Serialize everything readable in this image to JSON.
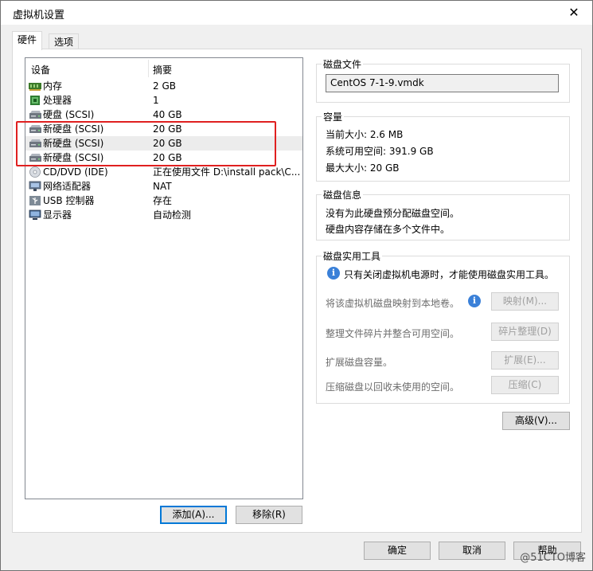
{
  "window": {
    "title": "虚拟机设置",
    "close_glyph": "✕"
  },
  "tabs": [
    {
      "label": "硬件"
    },
    {
      "label": "选项"
    }
  ],
  "device_list": {
    "col_device": "设备",
    "col_summary": "摘要",
    "rows": [
      {
        "name": "内存",
        "summary": "2 GB",
        "icon": "memory-icon"
      },
      {
        "name": "处理器",
        "summary": "1",
        "icon": "processor-icon"
      },
      {
        "name": "硬盘 (SCSI)",
        "summary": "40 GB",
        "icon": "hard-disk-icon"
      },
      {
        "name": "新硬盘 (SCSI)",
        "summary": "20 GB",
        "icon": "hard-disk-icon"
      },
      {
        "name": "新硬盘 (SCSI)",
        "summary": "20 GB",
        "icon": "hard-disk-icon"
      },
      {
        "name": "新硬盘 (SCSI)",
        "summary": "20 GB",
        "icon": "hard-disk-icon"
      },
      {
        "name": "CD/DVD (IDE)",
        "summary": "正在使用文件 D:\\install pack\\C...",
        "icon": "cd-dvd-icon"
      },
      {
        "name": "网络适配器",
        "summary": "NAT",
        "icon": "network-adapter-icon"
      },
      {
        "name": "USB 控制器",
        "summary": "存在",
        "icon": "usb-icon"
      },
      {
        "name": "显示器",
        "summary": "自动检测",
        "icon": "display-icon"
      }
    ],
    "selected_index": 4
  },
  "list_buttons": {
    "add": "添加(A)...",
    "remove": "移除(R)"
  },
  "disk_file": {
    "title": "磁盘文件",
    "value": "CentOS 7-1-9.vmdk"
  },
  "capacity": {
    "title": "容量",
    "current_size": "当前大小: 2.6 MB",
    "system_free": "系统可用空间: 391.9 GB",
    "max_size": "最大大小: 20 GB"
  },
  "disk_info": {
    "title": "磁盘信息",
    "line1": "没有为此硬盘预分配磁盘空间。",
    "line2": "硬盘内容存储在多个文件中。"
  },
  "disk_utilities": {
    "title": "磁盘实用工具",
    "notice": "只有关闭虚拟机电源时，才能使用磁盘实用工具。",
    "map_text": "将该虚拟机磁盘映射到本地卷。",
    "map_button": "映射(M)...",
    "defrag_text": "整理文件碎片并整合可用空间。",
    "defrag_button": "碎片整理(D)",
    "expand_text": "扩展磁盘容量。",
    "expand_button": "扩展(E)...",
    "compact_text": "压缩磁盘以回收未使用的空间。",
    "compact_button": "压缩(C)"
  },
  "advanced_button": "高级(V)...",
  "footer": {
    "ok": "确定",
    "cancel": "取消",
    "help": "帮助"
  },
  "watermark": "@51CTO博客",
  "colors": {
    "highlight_border": "#e02020",
    "default_button_border": "#0078d7",
    "info_icon": "#3a80d8"
  }
}
